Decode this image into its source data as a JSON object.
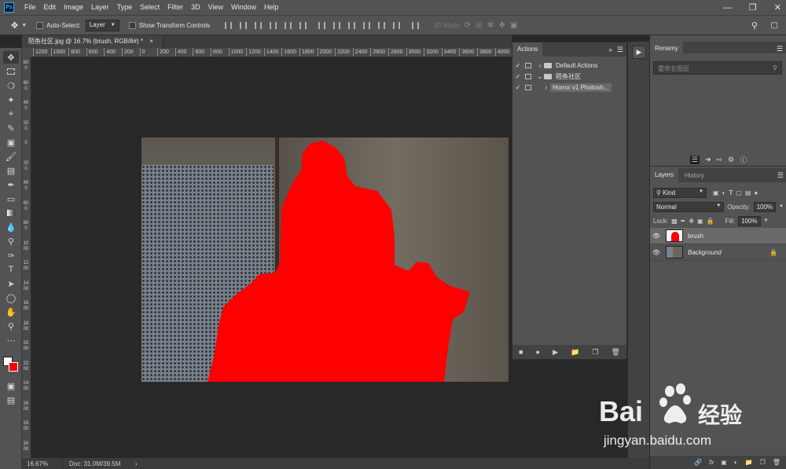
{
  "app": {
    "logo_text": "Ps"
  },
  "menubar": {
    "items": [
      "File",
      "Edit",
      "Image",
      "Layer",
      "Type",
      "Select",
      "Filter",
      "3D",
      "View",
      "Window",
      "Help"
    ]
  },
  "options_bar": {
    "auto_select_label": "Auto-Select:",
    "auto_select_target": "Layer",
    "show_transform_label": "Show Transform Controls",
    "mode_3d_label": "3D Mode:"
  },
  "document": {
    "tab_title": "陌鱼社区.jpg @ 16.7% (brush, RGB/8#) *",
    "ruler_top_labels": [
      "1200",
      "1000",
      "800",
      "600",
      "400",
      "200",
      "0",
      "200",
      "400",
      "600",
      "800",
      "1000",
      "1200",
      "1400",
      "1600",
      "1800",
      "2000",
      "2200",
      "2400",
      "2600",
      "2800",
      "3000",
      "3200",
      "3400",
      "3600",
      "3800",
      "4000"
    ],
    "ruler_left_labels": [
      "800",
      "600",
      "400",
      "200",
      "0",
      "200",
      "400",
      "600",
      "800",
      "1000",
      "1200",
      "1400",
      "1600",
      "1800",
      "2000",
      "2200",
      "2400",
      "2600",
      "2800",
      "3000"
    ],
    "brush_color": "#ff0000"
  },
  "status": {
    "zoom": "16.67%",
    "doc": "Doc: 31.0M/39.5M"
  },
  "actions_panel": {
    "title": "Actions",
    "rows": [
      {
        "label": "Default Actions"
      },
      {
        "label": "陌鱼社区"
      },
      {
        "label": "Horror v1 Photosh..."
      }
    ]
  },
  "renamy_panel": {
    "title": "Renamy",
    "search_placeholder": "重命名图层"
  },
  "layers_panel": {
    "tabs": [
      "Layers",
      "History"
    ],
    "filter_label": "Kind",
    "blend_mode": "Normal",
    "opacity_label": "Opacity:",
    "opacity_value": "100%",
    "lock_label": "Lock:",
    "fill_label": "Fill:",
    "fill_value": "100%",
    "layers": [
      {
        "name": "brush",
        "selected": true
      },
      {
        "name": "Background",
        "selected": false
      }
    ],
    "bottom_fx": "fx"
  },
  "watermark": {
    "brand": "Bai",
    "brand_suffix": "经验",
    "url": "jingyan.baidu.com"
  }
}
